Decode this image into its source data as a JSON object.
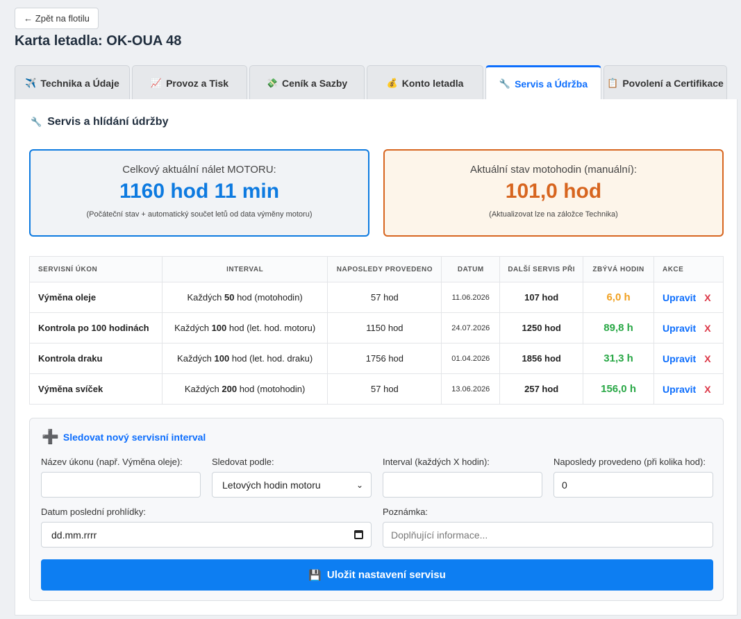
{
  "back_label": "← Zpět na flotilu",
  "page_title": "Karta letadla: OK-OUA 48",
  "tabs": [
    {
      "icon": "✈️",
      "label": "Technika a Údaje"
    },
    {
      "icon": "📈",
      "label": "Provoz a Tisk"
    },
    {
      "icon": "💸",
      "label": "Ceník a Sazby"
    },
    {
      "icon": "💰",
      "label": "Konto letadla"
    },
    {
      "icon": "🔧",
      "label": "Servis a Údržba"
    },
    {
      "icon": "📋",
      "label": "Povolení a Certifikace"
    }
  ],
  "active_tab": "Servis a Údržba",
  "section": {
    "icon": "🔧",
    "title": "Servis a hlídání údržby"
  },
  "engine_card": {
    "label": "Celkový aktuální nálet MOTORU:",
    "value": "1160 hod 11 min",
    "note": "(Počáteční stav + automatický součet letů od data výměny motoru)"
  },
  "motohours_card": {
    "label": "Aktuální stav motohodin (manuální):",
    "value": "101,0 hod",
    "note": "(Aktualizovat lze na záložce Technika)"
  },
  "table": {
    "headers": [
      "Servisní úkon",
      "Interval",
      "Naposledy provedeno",
      "Datum",
      "Další servis při",
      "Zbývá hodin",
      "Akce"
    ],
    "rows": [
      {
        "name": "Výměna oleje",
        "interval_pre": "Každých ",
        "interval_num": "50",
        "interval_post": " hod (motohodin)",
        "last": "57 hod",
        "date": "11.06.2026",
        "next": "107 hod",
        "remaining": "6,0 h",
        "remaining_color": "#f0a020"
      },
      {
        "name": "Kontrola po 100 hodinách",
        "interval_pre": "Každých ",
        "interval_num": "100",
        "interval_post": " hod (let. hod. motoru)",
        "last": "1150 hod",
        "date": "24.07.2026",
        "next": "1250 hod",
        "remaining": "89,8 h",
        "remaining_color": "#28a745"
      },
      {
        "name": "Kontrola draku",
        "interval_pre": "Každých ",
        "interval_num": "100",
        "interval_post": " hod (let. hod. draku)",
        "last": "1756 hod",
        "date": "01.04.2026",
        "next": "1856 hod",
        "remaining": "31,3 h",
        "remaining_color": "#28a745"
      },
      {
        "name": "Výměna svíček",
        "interval_pre": "Každých ",
        "interval_num": "200",
        "interval_post": " hod (motohodin)",
        "last": "57 hod",
        "date": "13.06.2026",
        "next": "257 hod",
        "remaining": "156,0 h",
        "remaining_color": "#28a745"
      }
    ],
    "edit_label": "Upravit",
    "delete_label": "X"
  },
  "form": {
    "title_icon": "➕",
    "title": "Sledovat nový servisní interval",
    "name_label": "Název úkonu (např. Výměna oleje):",
    "name_value": "",
    "track_label": "Sledovat podle:",
    "track_value": "Letových hodin motoru",
    "interval_label": "Interval (každých X hodin):",
    "interval_value": "",
    "last_label": "Naposledy provedeno (při kolika hod):",
    "last_value": "0",
    "date_label": "Datum poslední prohlídky:",
    "date_value": "dd.mm.rrrr",
    "note_label": "Poznámka:",
    "note_placeholder": "Doplňující informace...",
    "save_icon": "💾",
    "save_label": "Uložit nastavení servisu"
  }
}
